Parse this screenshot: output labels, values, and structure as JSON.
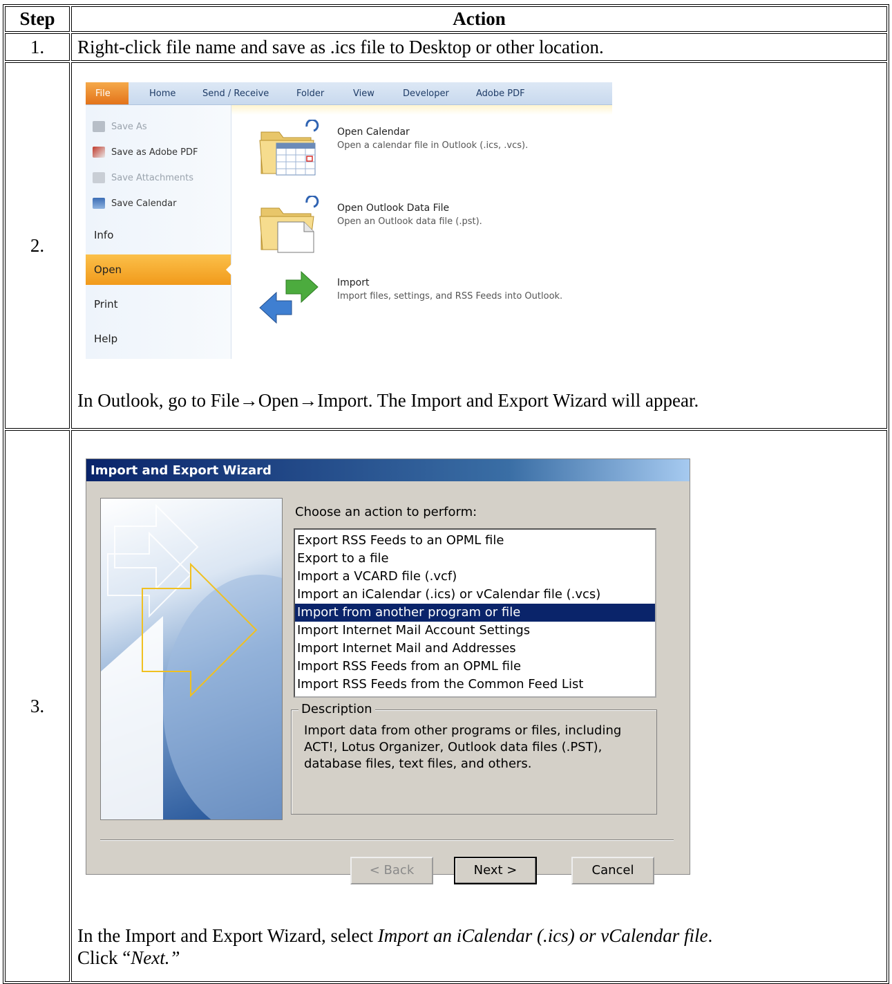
{
  "table": {
    "header": {
      "step": "Step",
      "action": "Action"
    },
    "rows": [
      {
        "step": "1.",
        "action": "Right-click file name and save as .ics file to Desktop or other location."
      },
      {
        "step": "2.",
        "caption": "In Outlook, go to File→Open→Import.  The Import and Export Wizard will appear."
      },
      {
        "step": "3.",
        "caption_part1": "In the Import and Export Wizard, select ",
        "caption_italic1": "Import an iCalendar (.ics) or vCalendar file",
        "caption_part2": ".",
        "caption_line2_pre": "Click “",
        "caption_italic2": "Next.”"
      }
    ]
  },
  "outlook": {
    "tabs": [
      "File",
      "Home",
      "Send / Receive",
      "Folder",
      "View",
      "Developer",
      "Adobe PDF"
    ],
    "save_items": [
      {
        "label": "Save As",
        "disabled": true,
        "icon": "save-as-icon"
      },
      {
        "label": "Save as Adobe PDF",
        "disabled": false,
        "icon": "pdf-icon"
      },
      {
        "label": "Save Attachments",
        "disabled": true,
        "icon": "attachment-icon"
      },
      {
        "label": "Save Calendar",
        "disabled": false,
        "icon": "calendar-icon"
      }
    ],
    "nav": [
      "Info",
      "Open",
      "Print",
      "Help"
    ],
    "active_nav": "Open",
    "options": [
      {
        "title": "Open Calendar",
        "desc": "Open a calendar file in Outlook (.ics, .vcs).",
        "icon": "open-calendar-icon"
      },
      {
        "title": "Open Outlook Data File",
        "desc": "Open an Outlook data file (.pst).",
        "icon": "open-data-file-icon"
      },
      {
        "title": "Import",
        "desc": "Import files, settings, and RSS Feeds into Outlook.",
        "icon": "import-arrows-icon"
      }
    ]
  },
  "wizard": {
    "title": "Import and Export Wizard",
    "prompt": "Choose an action to perform:",
    "list": [
      "Export RSS Feeds to an OPML file",
      "Export to a file",
      "Import a VCARD file (.vcf)",
      "Import an iCalendar (.ics) or vCalendar file (.vcs)",
      "Import from another program or file",
      "Import Internet Mail Account Settings",
      "Import Internet Mail and Addresses",
      "Import RSS Feeds from an OPML file",
      "Import RSS Feeds from the Common Feed List"
    ],
    "selected_index": 4,
    "description_label": "Description",
    "description_text": "Import data from other programs or files, including ACT!, Lotus Organizer, Outlook data files (.PST), database files, text files, and others.",
    "buttons": {
      "back": "< Back",
      "next": "Next >",
      "cancel": "Cancel"
    }
  }
}
